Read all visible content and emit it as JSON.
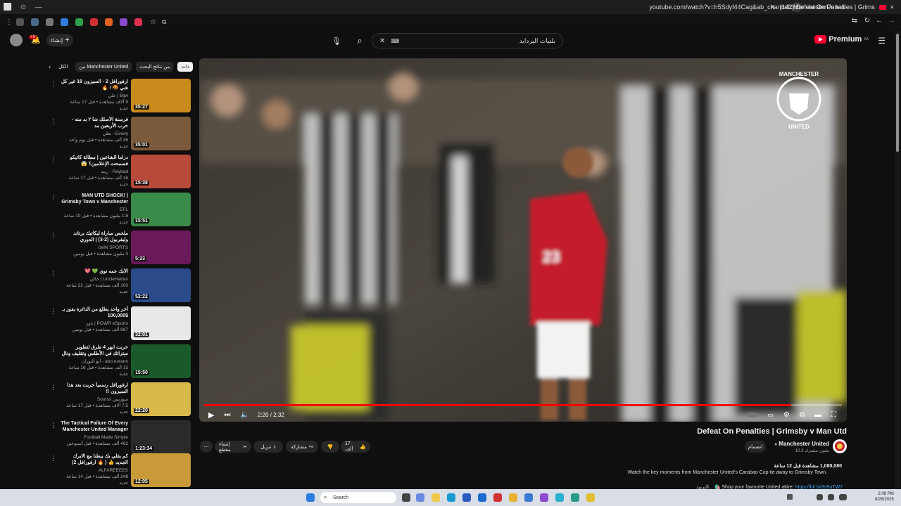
{
  "browser": {
    "tab_title": "(142) Defeat On Penalties | Grims",
    "url": "youtube.com/watch?v=h5Sdyf44Cag&ab_channel=ManchesterUnited",
    "new_tab": "+"
  },
  "header": {
    "search_value": "بلتيات اليردايد",
    "create_label": "إنشاء",
    "notif_count": "+9",
    "logo": "Premium",
    "logo_region": "SA"
  },
  "chips": [
    "الكل",
    "من Manchester United",
    "من نتائج البحث",
    "ذات"
  ],
  "related": [
    {
      "title": "ارفورافل 2 - السيزون 18 غير كل شي 🤬 ! 🔥",
      "channel": "Bijw | علي",
      "meta": "9 آلاف مشاهدة • قبل 17 ساعة",
      "badge": "جديد",
      "duration": "35:27",
      "thumb": "#c98a1e"
    },
    {
      "title": "فرسنة الأصلك شأ ٢ بد منه - حرب الأربعين مد",
      "channel": "Evooy - بعلي",
      "meta": "36 ألف مشاهدة • قبل يوم واحد",
      "badge": "جديد",
      "duration": "35:01",
      "thumb": "#7a5a3a"
    },
    {
      "title": "دراما الشاعين | مطالة كاتيكو فسمحت الإعلامين؟ 😱",
      "channel": "Reybad - ريبد",
      "meta": "16 ألف مشاهدة • قبل 17 ساعة",
      "badge": "جديد",
      "duration": "15:38",
      "thumb": "#b84a3a"
    },
    {
      "title": "MAN UTD SHOCK! | Grimsby Town v Manchester United ...",
      "channel": "EFL",
      "meta": "1.8 مليون مشاهدة • قبل 10 ساعة",
      "badge": "جديد",
      "duration": "15:51",
      "thumb": "#3a8a4a"
    },
    {
      "title": "ملخص مباراة ليكاتيك برتاند وليفربول (2-3) | الدوري الإنجليزي - الجولة الثانية",
      "channel": "beIN SPORTS",
      "meta": "3 مليون مشاهدة • قبل يومين",
      "badge": "",
      "duration": "5:33",
      "thumb": "#6a1a5a"
    },
    {
      "title": "الأبك عمه نوي 💚 💖",
      "channel": "UncleHattan | خالي",
      "meta": "100 ألف مشاهدة • قبل 22 ساعة",
      "badge": "جديد",
      "duration": "52:22",
      "thumb": "#2a4a8a"
    },
    {
      "title": "آخر واحد يطلع من الدائرة يفوز بـ $100,000",
      "channel": "POWR eSports | باور",
      "meta": "887 ألف مشاهدة • قبل يومين",
      "badge": "",
      "duration": "32:01",
      "thumb": "#e8e8e8"
    },
    {
      "title": "خربت ابهر 4 طرق لتطوير ستراتك في الأطلس وتقليف ونال الأفضل",
      "channel": "abo.norann - أبو النوران",
      "meta": "15 ألف مشاهدة • قبل 16 ساعة",
      "badge": "جديد",
      "duration": "15:50",
      "thumb": "#1a5a2a"
    },
    {
      "title": "ارفورافل رسمياً خربت بعد هذا السيزون !!",
      "channel": "سوريس Sourss",
      "meta": "7.5 آلاف مشاهدة • قبل 17 ساعة",
      "badge": "جديد",
      "duration": "22:20",
      "thumb": "#d8b84a"
    },
    {
      "title": "The Tactical Failure Of Every Manchester United Manager",
      "channel": "Football Made Simple",
      "meta": "462 ألف مشاهدة • قبل أسبوعين",
      "badge": "",
      "duration": "1:23:34",
      "thumb": "#2a2a2a"
    },
    {
      "title": "كم بقلي بك بيطنا مع الابرك الجديد 👍 ( 🔥 ارفورافل 2)",
      "channel": "ALFAREEEES",
      "meta": "248 ألف مشاهدة • قبل 14 ساعة",
      "badge": "جديد",
      "duration": "12:05",
      "thumb": "#c89a3a"
    }
  ],
  "player": {
    "time": "2:20 / 2:32",
    "progress": 0.92,
    "logo_line1": "MANCHESTER",
    "logo_line2": "UNITED"
  },
  "video": {
    "title": "Defeat On Penalties | Grimsby v Man Utd",
    "channel": "Manchester United",
    "subscribers": "10.3 مليون مشترك",
    "join_label": "انضمام",
    "likes": "17 ألف",
    "share": "مشاركة",
    "download": "تنزيل",
    "clip": "إنشاء مقطع",
    "views": "1,080,080 مشاهدة قبل 12 ساعة",
    "description": "Watch the key moments from Manchester United's Carabao Cup tie away to Grimsby Town.",
    "link_prefix": "التربيد... 🛍️ Shop your favourite United attire:",
    "link": "https://bit.ly/3s9uTW7"
  },
  "taskbar": {
    "search_label": "Search",
    "time": "2:08 PM",
    "date": "8/28/2025"
  },
  "colors": {
    "accent": "#ff0000",
    "bg": "#0f0f0f",
    "taskbar": "#d9dee6"
  }
}
